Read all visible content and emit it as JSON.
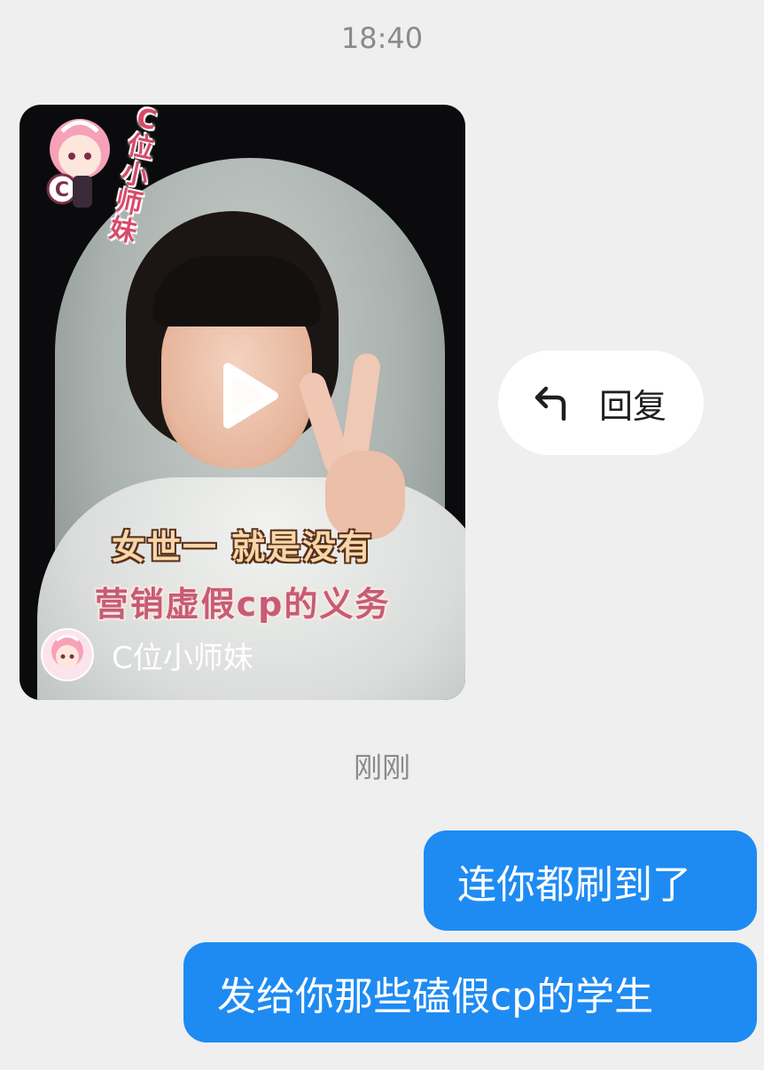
{
  "timestamps": {
    "first": "18:40",
    "second": "刚刚"
  },
  "video_card": {
    "sticker_text": "C位小师妹",
    "caption_line1": "女世一 就是没有",
    "caption_line2": "营销虚假cp的义务",
    "author_name": "C位小师妹",
    "play_icon": "play-icon"
  },
  "reply": {
    "label": "回复",
    "icon": "reply-arrow-icon"
  },
  "messages": [
    {
      "text": "连你都刷到了"
    },
    {
      "text": "发给你那些磕假cp的学生"
    }
  ],
  "colors": {
    "background": "#efefef",
    "bubble": "#1e8bf3",
    "timestamp": "#8a8a8a"
  }
}
